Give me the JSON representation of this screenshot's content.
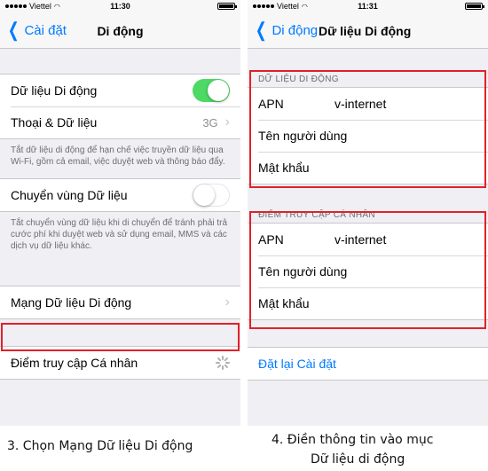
{
  "left": {
    "status": {
      "carrier": "Viettel",
      "time": "11:30"
    },
    "nav": {
      "back": "Cài đặt",
      "title": "Di động"
    },
    "cells": {
      "cellular_data": "Dữ liệu Di động",
      "voice_data": "Thoại & Dữ liệu",
      "voice_data_value": "3G",
      "data_roaming": "Chuyển vùng Dữ liệu",
      "cellular_network": "Mạng Dữ liệu Di động",
      "hotspot": "Điểm truy cập Cá nhân"
    },
    "toggles": {
      "cellular_data": "on",
      "data_roaming": "off"
    },
    "notes": {
      "cellular": "Tắt dữ liệu di động để hạn chế việc truyền dữ liệu qua Wi-Fi, gồm cả email, việc duyệt web và thông báo đẩy.",
      "roaming": "Tắt chuyển vùng dữ liệu khi di chuyển để tránh phải trả cước phí khi duyệt web và sử dụng email, MMS và các dịch vụ dữ liệu khác."
    },
    "caption": "3. Chọn Mạng Dữ liệu Di động"
  },
  "right": {
    "status": {
      "carrier": "Viettel",
      "time": "11:31"
    },
    "nav": {
      "back": "Di động",
      "title": "Dữ liệu Di động"
    },
    "section1": {
      "header": "DỮ LIỆU DI ĐỘNG",
      "apn_label": "APN",
      "apn_value": "v-internet",
      "user_label": "Tên người dùng",
      "pass_label": "Mật khẩu"
    },
    "section2": {
      "header": "ĐIỂM TRUY CẬP CÁ NHÂN",
      "apn_label": "APN",
      "apn_value": "v-internet",
      "user_label": "Tên người dùng",
      "pass_label": "Mật khẩu"
    },
    "reset": "Đặt lại Cài đặt",
    "caption_line1": "4. Điền thông tin vào mục",
    "caption_line2": "Dữ liệu di động"
  },
  "colors": {
    "accent": "#007aff",
    "toggle_on": "#4cd964",
    "highlight": "#e3202a"
  },
  "icons": [
    "chevron-left-icon",
    "chevron-right-icon",
    "signal-dots-icon",
    "wifi-icon",
    "battery-icon",
    "spinner-icon"
  ]
}
